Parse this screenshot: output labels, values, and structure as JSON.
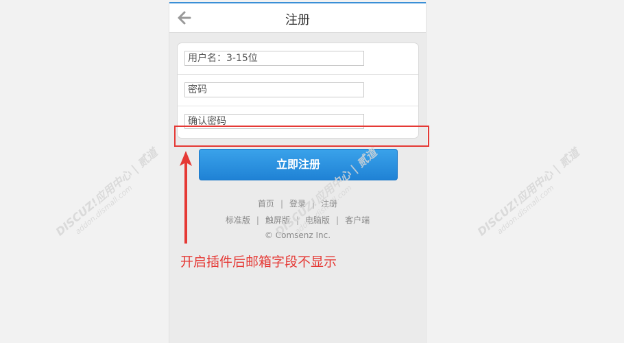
{
  "header": {
    "title": "注册",
    "back_icon": "arrow-left-icon"
  },
  "form": {
    "username_placeholder": "用户名：3-15位",
    "password_placeholder": "密码",
    "confirm_placeholder": "确认密码"
  },
  "submit": {
    "label": "立即注册"
  },
  "footer": {
    "link_home": "首页",
    "link_login": "登录",
    "link_register": "注册",
    "link_standard": "标准版",
    "link_touch": "触屏版",
    "link_pc": "电脑版",
    "link_client": "客户端",
    "copyright": "© Comsenz Inc."
  },
  "annotation": {
    "text": "开启插件后邮箱字段不显示",
    "color": "#e53935"
  },
  "watermark": {
    "brand": "DISCUZ!应用中心",
    "tag": "贰道",
    "url": "addon.dismall.com"
  },
  "colors": {
    "accent": "#1f82d5",
    "highlight": "#e53935"
  }
}
